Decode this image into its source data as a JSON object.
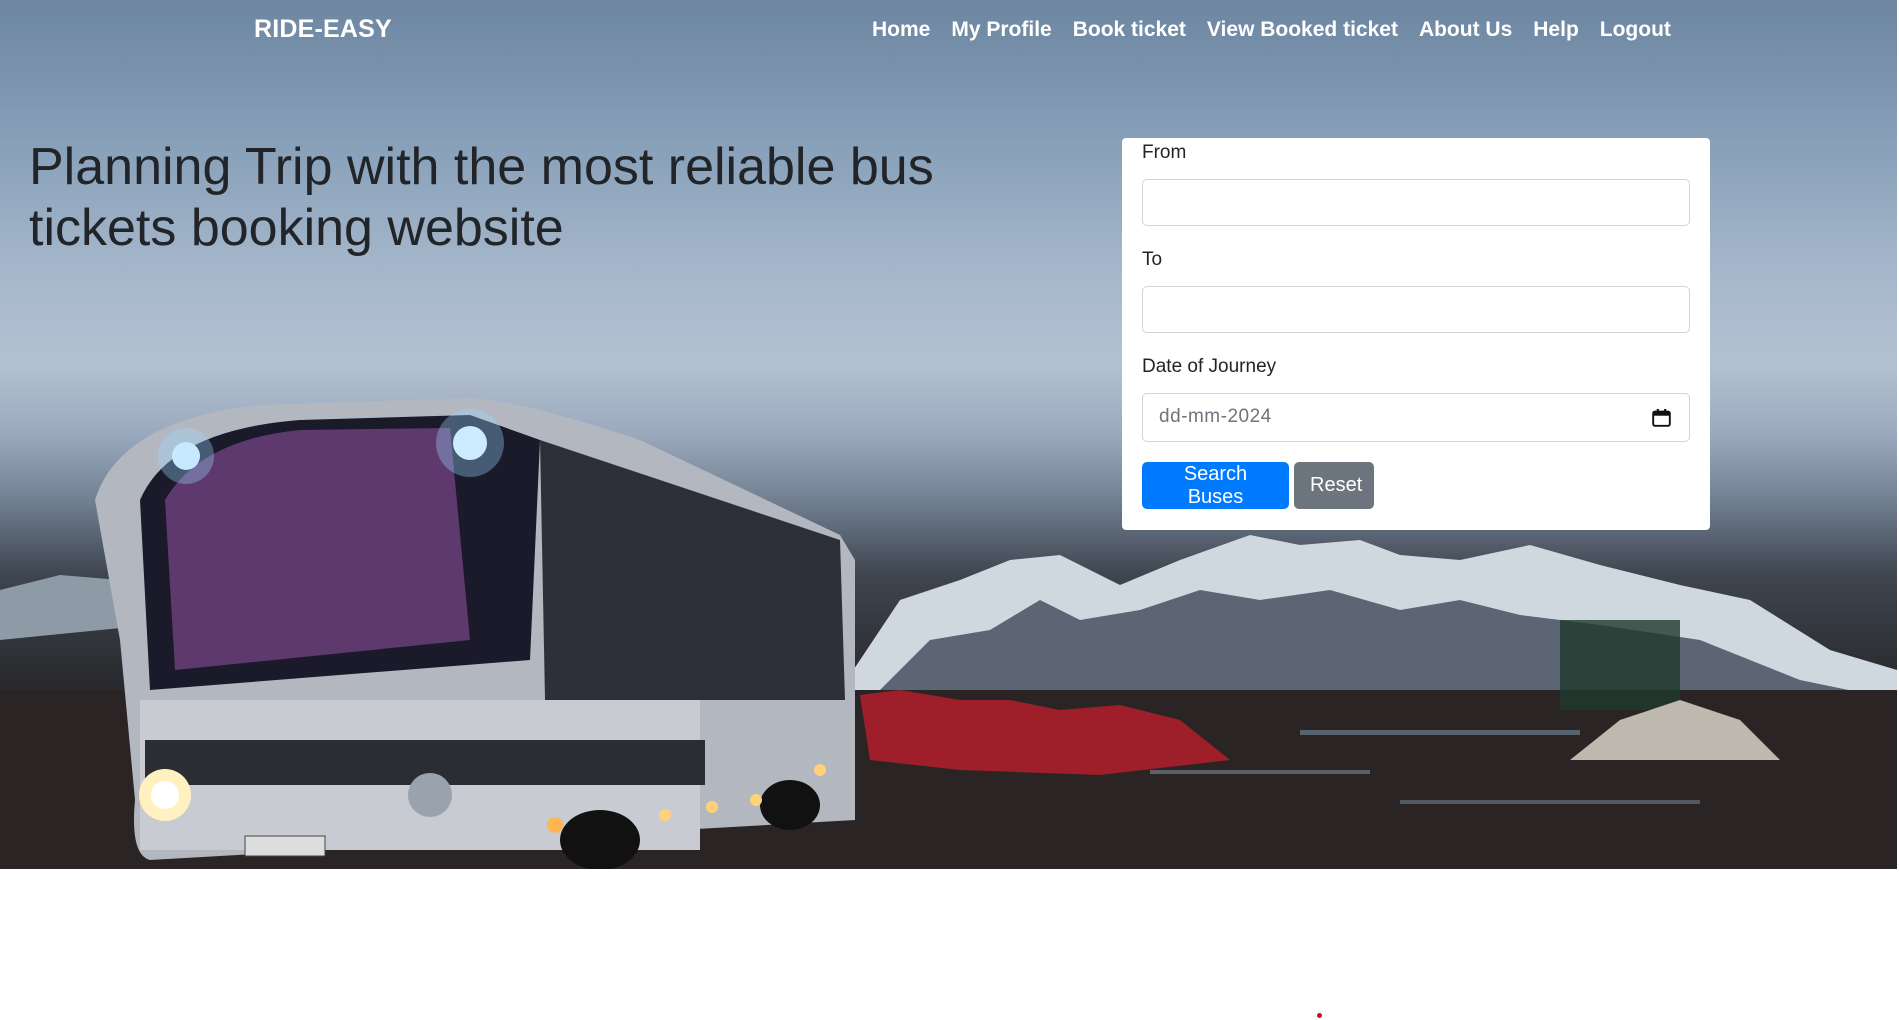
{
  "brand": "RIDE-EASY",
  "nav": {
    "items": [
      {
        "label": "Home"
      },
      {
        "label": "My Profile"
      },
      {
        "label": "Book ticket"
      },
      {
        "label": "View Booked ticket"
      },
      {
        "label": "About Us"
      },
      {
        "label": "Help"
      },
      {
        "label": "Logout"
      }
    ]
  },
  "hero": {
    "headline": "Planning Trip with the most reliable bus tickets booking website"
  },
  "search_form": {
    "from_label": "From",
    "from_value": "",
    "to_label": "To",
    "to_value": "",
    "date_label": "Date of Journey",
    "date_placeholder": "dd-mm-2024",
    "search_button": "Search Buses",
    "reset_button": "Reset"
  },
  "colors": {
    "primary": "#007bff",
    "secondary": "#6c757d",
    "text": "#212529"
  },
  "icons": {
    "date_icon": "calendar-icon"
  }
}
